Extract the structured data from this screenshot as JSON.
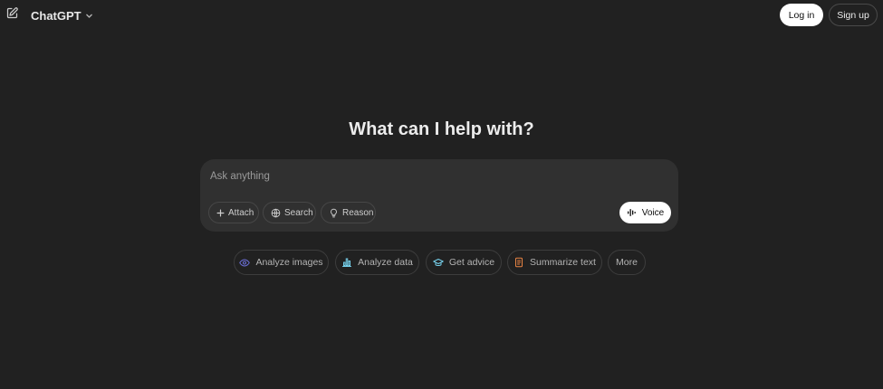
{
  "header": {
    "model_name": "ChatGPT",
    "new_chat_icon": "edit-square-icon",
    "model_dropdown_icon": "chevron-down-icon",
    "login_label": "Log in",
    "signup_label": "Sign up"
  },
  "main": {
    "heading": "What can I help with?"
  },
  "composer": {
    "placeholder": "Ask anything",
    "value": "",
    "tools": [
      {
        "label": "Attach",
        "icon": "plus-icon"
      },
      {
        "label": "Search",
        "icon": "globe-icon"
      },
      {
        "label": "Reason",
        "icon": "lightbulb-icon"
      }
    ],
    "voice": {
      "label": "Voice",
      "icon": "waveform-icon"
    }
  },
  "suggestions": [
    {
      "label": "Analyze images",
      "icon": "eye-icon",
      "color": "#6b6fd6"
    },
    {
      "label": "Analyze data",
      "icon": "bar-chart-icon",
      "color": "#76d0eb"
    },
    {
      "label": "Get advice",
      "icon": "graduation-cap-icon",
      "color": "#76d0eb"
    },
    {
      "label": "Summarize text",
      "icon": "document-icon",
      "color": "#ea8444"
    },
    {
      "label": "More",
      "icon": "",
      "color": ""
    }
  ],
  "colors": {
    "background": "#212121",
    "composer_bg": "#303030",
    "primary_button_bg": "#ffffff"
  }
}
